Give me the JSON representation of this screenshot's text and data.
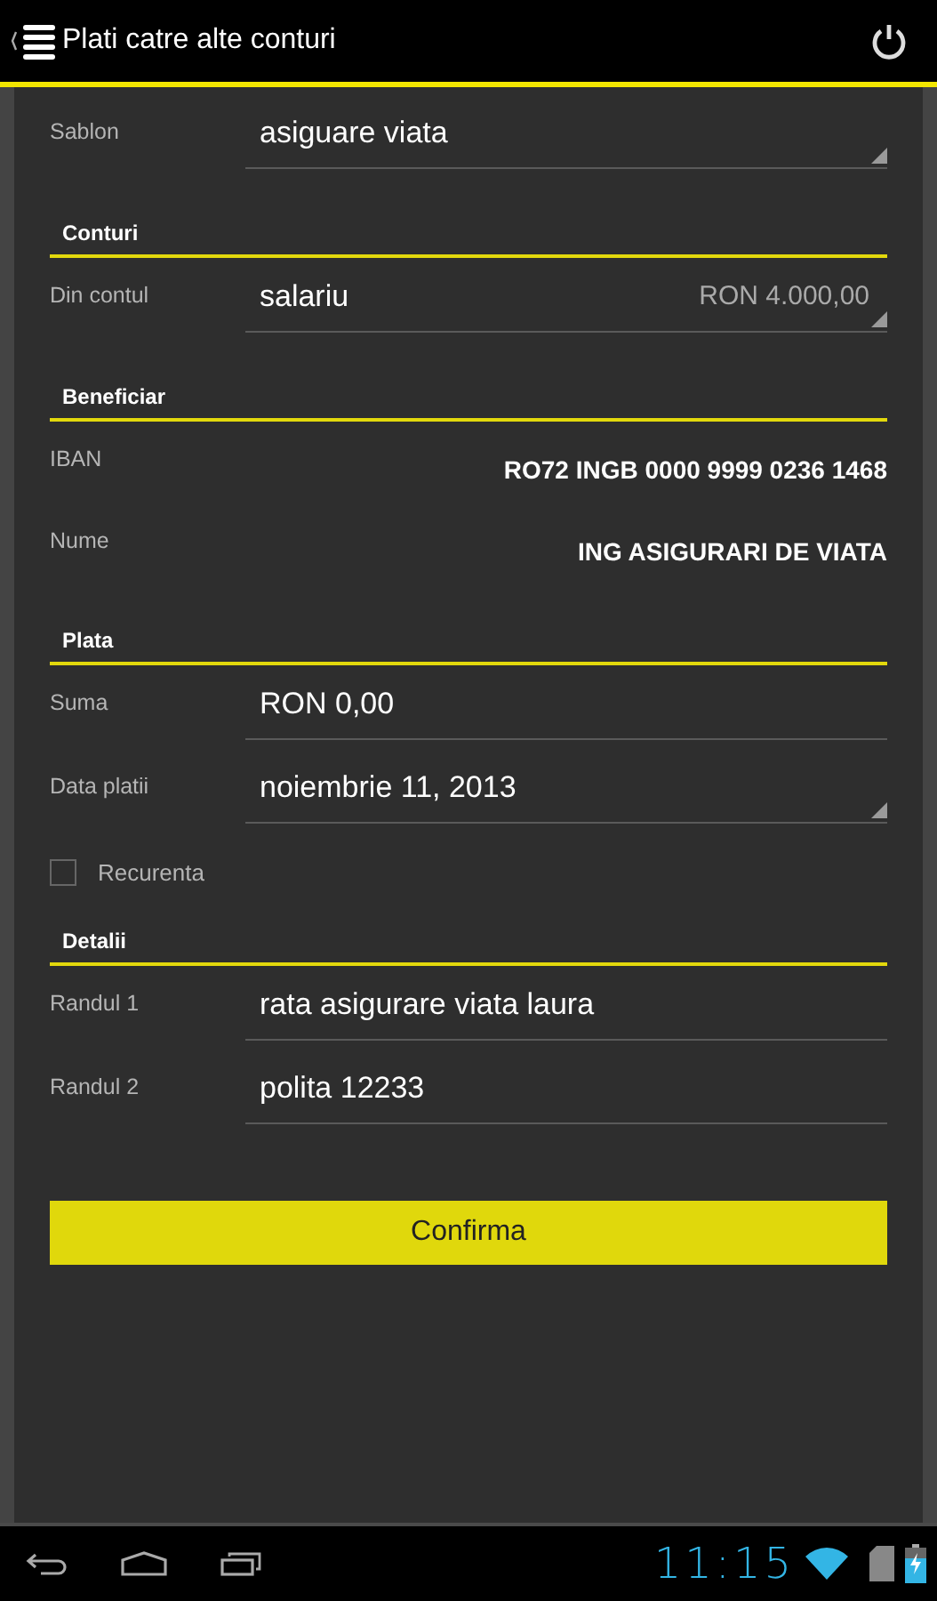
{
  "header": {
    "title": "Plati catre alte conturi"
  },
  "sections": [
    {
      "rows": [
        {
          "kind": "dropdown",
          "label": "Sablon",
          "value": "asiguare viata"
        }
      ]
    },
    {
      "title": "Conturi",
      "rows": [
        {
          "kind": "dropdown",
          "label": "Din contul",
          "value": "salariu",
          "extra": "RON 4.000,00"
        }
      ]
    },
    {
      "title": "Beneficiar",
      "rows": [
        {
          "kind": "readonly",
          "label": "IBAN",
          "value": "RO72 INGB 0000 9999 0236 1468"
        },
        {
          "kind": "readonly",
          "label": "Nume",
          "value": "ING ASIGURARI DE VIATA"
        }
      ]
    },
    {
      "title": "Plata",
      "rows": [
        {
          "kind": "field",
          "label": "Suma",
          "value": "RON 0,00"
        },
        {
          "kind": "dropdown",
          "label": "Data platii",
          "value": "noiembrie 11, 2013"
        },
        {
          "kind": "checkbox",
          "label": "Recurenta",
          "checked": false
        }
      ]
    },
    {
      "title": "Detalii",
      "rows": [
        {
          "kind": "field",
          "label": "Randul 1",
          "value": "rata asigurare viata laura"
        },
        {
          "kind": "field",
          "label": "Randul 2",
          "value": "polita 12233"
        }
      ]
    }
  ],
  "confirm_button": "Confirma",
  "status_bar": {
    "time": "11:15"
  }
}
